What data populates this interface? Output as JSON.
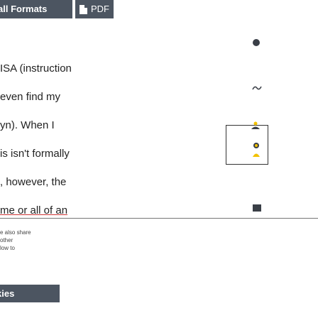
{
  "toolbar": {
    "formats_label": "all Formats",
    "pdf_label": "PDF"
  },
  "article": {
    "lines": [
      "ISA (instruction",
      "even find my",
      "yn). When I",
      "is isn't formally",
      ", however, the",
      "me or all of an"
    ]
  },
  "footer": {
    "lines": [
      "e also share",
      "other",
      "low to"
    ],
    "cookies_label": "kies"
  },
  "icons": {
    "dot": "circle-icon",
    "wave": "wave-icon",
    "box": "frame-icon",
    "person": "person-icon",
    "folder": "folder-icon"
  }
}
